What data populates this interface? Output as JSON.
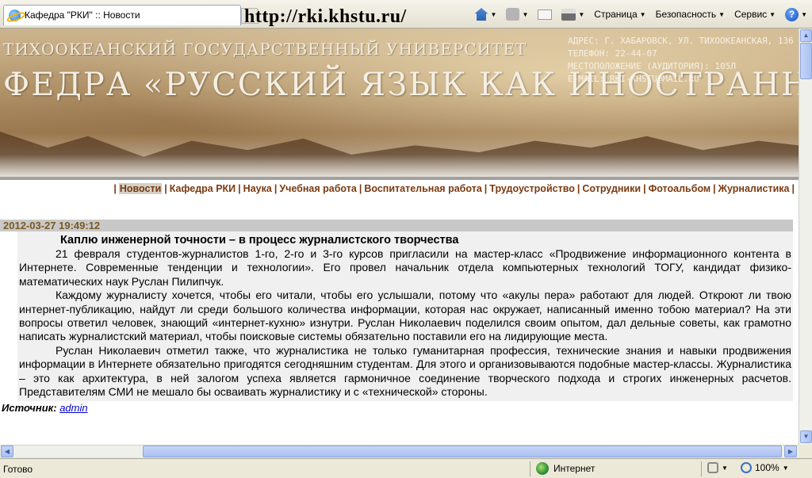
{
  "browser": {
    "tab_title": "Кафедра \"РКИ\" :: Новости",
    "overlay_url": "http://rki.khstu.ru/",
    "command_bar": {
      "page_label": "Страница",
      "safety_label": "Безопасность",
      "tools_label": "Сервис"
    },
    "status": {
      "ready": "Готово",
      "zone": "Интернет",
      "zoom": "100%"
    }
  },
  "header": {
    "university": "ТИХООКЕАНСКИЙ ГОСУДАРСТВЕННЫЙ УНИВЕРСИТЕТ",
    "department": "ФЕДРА «РУССКИЙ ЯЗЫК  КАК ИНОСТРАННЫЙ»",
    "contacts": [
      "АДРЕС: Г. ХАБАРОВСК, УЛ. ТИХООКЕАНСКАЯ, 136",
      "ТЕЛЕФОН: 22-44-07",
      "МЕСТОПОЛОЖЕНИЕ (АУДИТОРИЯ): 105Л",
      "E-MAIL: RKI-KHSTU@MAIL.RU"
    ]
  },
  "nav": {
    "items": [
      "Новости",
      "Кафедра РКИ",
      "Наука",
      "Учебная работа",
      "Воспитательная работа",
      "Трудоустройство",
      "Сотрудники",
      "Фотоальбом",
      "Журналистика"
    ],
    "active_index": 0
  },
  "article": {
    "date": "2012-03-27 19:49:12",
    "title": "Каплю инженерной точности – в процесс журналистского творчества",
    "paragraphs": [
      "21 февраля студентов-журналистов 1-го, 2-го и 3-го курсов пригласили на мастер-класс «Продвижение информационного контента в Интернете. Современные тенденции и технологии». Его провел начальник отдела компьютерных технологий ТОГУ, кандидат физико-математических наук Руслан Пилипчук.",
      "Каждому журналисту хочется, чтобы его читали, чтобы его услышали, потому что «акулы пера» работают для людей. Откроют ли твою интернет-публикацию, найдут ли среди большого количества информации, которая нас окружает, написанный именно тобою материал? На эти вопросы ответил человек, знающий «интернет-кухню» изнутри. Руслан Николаевич поделился своим опытом, дал дельные советы, как грамотно написать журналистский материал, чтобы поисковые системы обязательно поставили его на лидирующие места.",
      "Руслан Николаевич отметил также, что журналистика не только гуманитарная профессия, технические знания и навыки продвижения информации в Интернете обязательно пригодятся сегодняшним студентам. Для этого и организовываются подобные мастер-классы. Журналистика – это как архитектура, в ней залогом успеха является гармоничное соединение творческого подхода и строгих инженерных расчетов. Представителям СМИ не мешало бы осваивать журналистику и с «технической» стороны."
    ],
    "source_label": "Источник:",
    "source_link": "admin"
  }
}
